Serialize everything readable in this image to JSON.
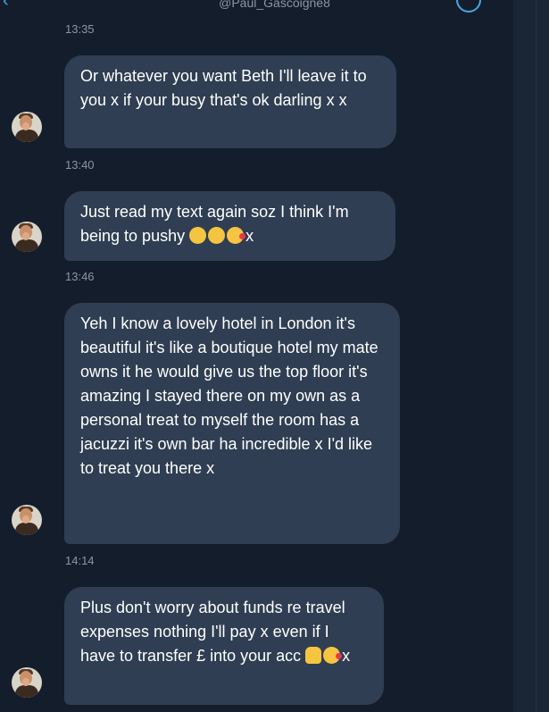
{
  "header": {
    "handle": "@Paul_Gascoigne8"
  },
  "messages": [
    {
      "time": "13:35",
      "text": "Or whatever you want Beth I'll leave it to you x if your busy that's ok darling x x"
    },
    {
      "time": "13:40",
      "text": "Just read my text again soz I think I'm being to pushy",
      "emojis": [
        "grimacing-face",
        "shushing-face",
        "face-blowing-kiss"
      ],
      "suffix": "x"
    },
    {
      "time": "13:46",
      "text": "Yeh I know a lovely hotel in London it's beautiful it's like a boutique hotel my mate owns it he would give us the top floor it's amazing I stayed there on my own as a personal treat to myself the room has a jacuzzi it's own bar ha incredible x I'd like to treat you there x"
    },
    {
      "time": "14:14",
      "text": "Plus don't worry about funds re travel expenses nothing I'll pay x even if I have to transfer £ into your acc",
      "emojis": [
        "thumbs-up",
        "face-blowing-kiss"
      ],
      "suffix": "x"
    }
  ],
  "colors": {
    "background": "#141d2b",
    "bubble": "#2f3e52",
    "text": "#ffffff",
    "timestamp": "#8a96a6",
    "accent": "#4aa3df"
  }
}
